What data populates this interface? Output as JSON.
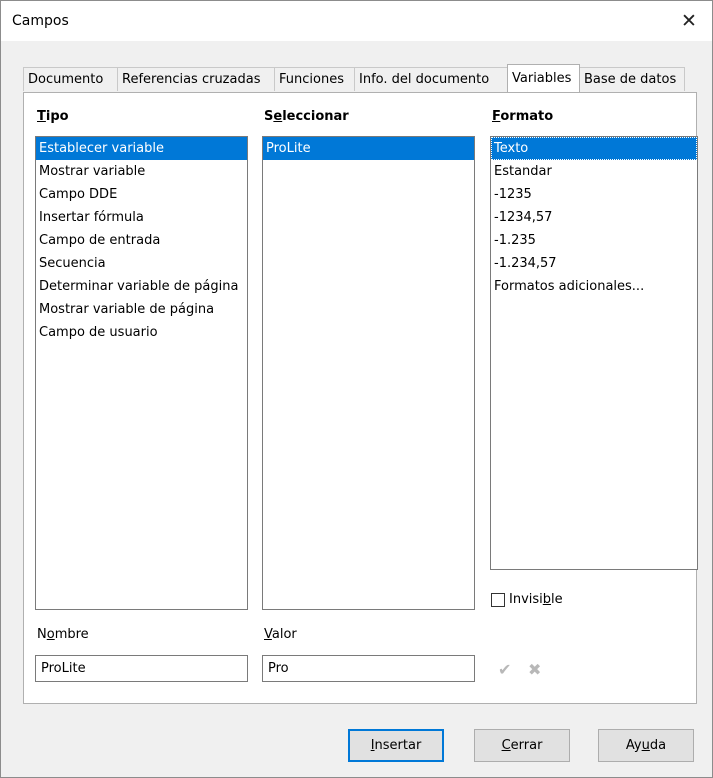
{
  "window": {
    "title": "Campos",
    "close_glyph": "✕"
  },
  "tabs": [
    {
      "label": "Documento"
    },
    {
      "label": "Referencias cruzadas"
    },
    {
      "label": "Funciones"
    },
    {
      "label": "Info. del documento"
    },
    {
      "label": "Variables",
      "active": true
    },
    {
      "label": "Base de datos"
    }
  ],
  "tipo": {
    "label_first": "T",
    "label_rest": "ipo",
    "items": [
      "Establecer variable",
      "Mostrar variable",
      "Campo DDE",
      "Insertar fórmula",
      "Campo de entrada",
      "Secuencia",
      "Determinar variable de página",
      "Mostrar variable de página",
      "Campo de usuario"
    ],
    "selected": "Establecer variable"
  },
  "seleccionar": {
    "label_first": "S",
    "label_mid": "e",
    "label_rest": "leccionar",
    "items": [
      "ProLite"
    ],
    "selected": "ProLite"
  },
  "formato": {
    "label_first": "F",
    "label_rest": "ormato",
    "items": [
      "Texto",
      "Estandar",
      "-1235",
      "-1234,57",
      "-1.235",
      "-1.234,57",
      "Formatos adicionales..."
    ],
    "selected": "Texto"
  },
  "invisible": {
    "label_pre": "Invisi",
    "label_ul": "b",
    "label_post": "le",
    "checked": false
  },
  "nombre": {
    "label_pre": "N",
    "label_ul": "o",
    "label_post": "mbre",
    "value": "ProLite"
  },
  "valor": {
    "label_ul": "V",
    "label_post": "alor",
    "value": "Pro"
  },
  "icons": {
    "apply": "check-icon",
    "delete": "x-icon",
    "apply_glyph": "✔",
    "delete_glyph": "✖"
  },
  "buttons": {
    "insertar": {
      "ul": "I",
      "rest": "nsertar"
    },
    "cerrar": {
      "ul": "C",
      "rest": "errar"
    },
    "ayuda": {
      "pre": "Ay",
      "ul": "u",
      "rest": "da"
    }
  }
}
